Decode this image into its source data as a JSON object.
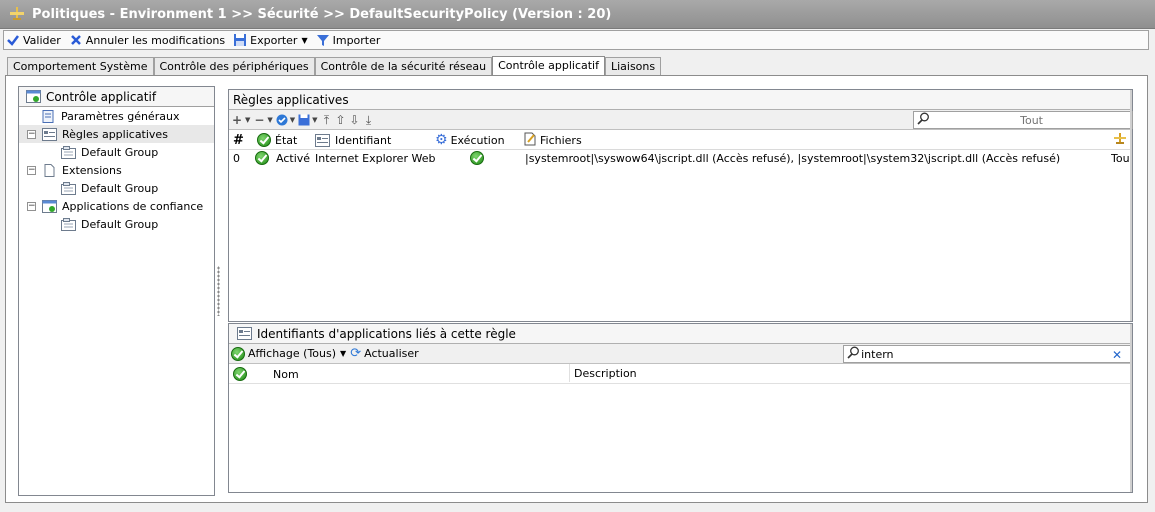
{
  "window": {
    "title": "Politiques - Environment 1 >> Sécurité >> DefaultSecurityPolicy (Version : 20)"
  },
  "toolbar": {
    "validate_label": "Valider",
    "cancel_label": "Annuler les modifications",
    "export_label": "Exporter",
    "import_label": "Importer"
  },
  "tabs": [
    {
      "label": "Comportement Système"
    },
    {
      "label": "Contrôle des périphériques"
    },
    {
      "label": "Contrôle de la sécurité réseau"
    },
    {
      "label": "Contrôle applicatif",
      "active": true
    },
    {
      "label": "Liaisons"
    }
  ],
  "tree": {
    "title": "Contrôle applicatif",
    "items": [
      {
        "label": "Paramètres généraux"
      },
      {
        "label": "Règles applicatives"
      },
      {
        "label": "Default Group"
      },
      {
        "label": "Extensions"
      },
      {
        "label": "Default Group"
      },
      {
        "label": "Applications de confiance"
      },
      {
        "label": "Default Group"
      }
    ]
  },
  "rules_panel": {
    "title": "Règles applicatives",
    "search_placeholder": "Tout",
    "columns": {
      "num": "#",
      "state": "État",
      "identifier": "Identifiant",
      "execution": "Exécution",
      "files": "Fichiers"
    },
    "rows": [
      {
        "num": "0",
        "state": "Activé",
        "identifier": "Internet Explorer Web...",
        "files": "|systemroot|\\syswow64\\jscript.dll (Accès refusé), |systemroot|\\system32\\jscript.dll (Accès refusé)",
        "extra": "Tou"
      }
    ]
  },
  "ids_panel": {
    "title": "Identifiants d'applications liés à cette règle",
    "view_label": "Affichage (Tous)",
    "refresh_label": "Actualiser",
    "search_value": "intern",
    "columns": {
      "name": "Nom",
      "description": "Description"
    }
  }
}
